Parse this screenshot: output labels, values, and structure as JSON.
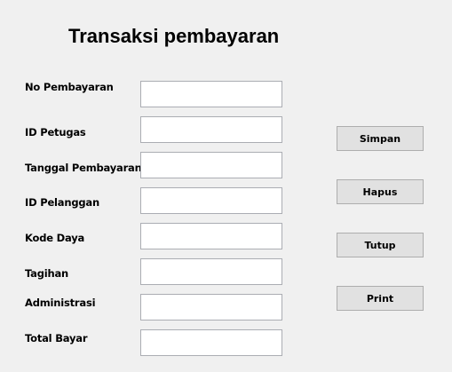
{
  "title": "Transaksi pembayaran",
  "fields": [
    {
      "label": "No Pembayaran",
      "value": ""
    },
    {
      "label": "ID Petugas",
      "value": ""
    },
    {
      "label": "Tanggal Pembayaran",
      "value": ""
    },
    {
      "label": "ID Pelanggan",
      "value": ""
    },
    {
      "label": "Kode Daya",
      "value": ""
    },
    {
      "label": "Tagihan",
      "value": ""
    },
    {
      "label": "Administrasi",
      "value": ""
    },
    {
      "label": "Total Bayar",
      "value": ""
    }
  ],
  "buttons": {
    "simpan": "Simpan",
    "hapus": "Hapus",
    "tutup": "Tutup",
    "print": "Print"
  }
}
